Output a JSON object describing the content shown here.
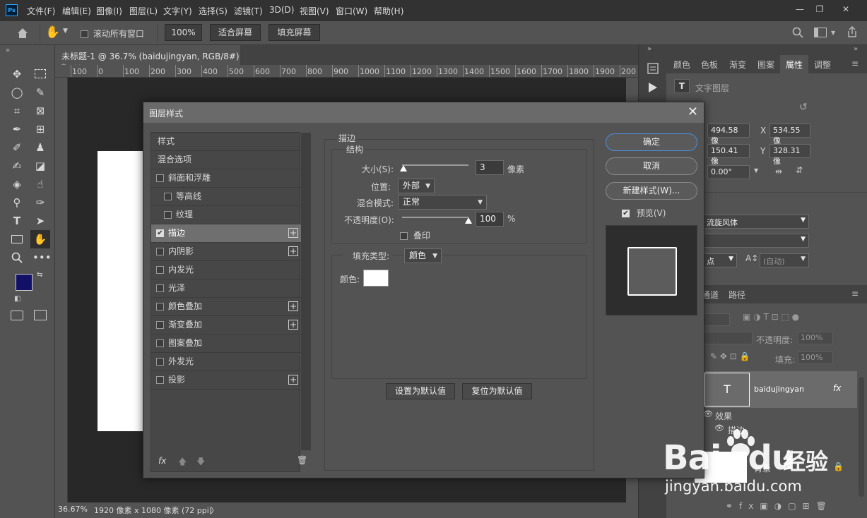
{
  "menubar": {
    "logo": "Ps",
    "items": [
      "文件(F)",
      "编辑(E)",
      "图像(I)",
      "图层(L)",
      "文字(Y)",
      "选择(S)",
      "滤镜(T)",
      "3D(D)",
      "视图(V)",
      "窗口(W)",
      "帮助(H)"
    ],
    "minimize": "—",
    "restore": "❐",
    "close": "✕"
  },
  "options": {
    "scroll_all_label": "滚动所有窗口",
    "zoom_value": "100%",
    "fit_screen": "适合屏幕",
    "fill_screen": "填充屏幕"
  },
  "document": {
    "tab_title": "未标题-1 @ 36.7% (baidujingyan, RGB/8#) *",
    "tab_close": "×",
    "ruler_ticks": [
      "100",
      "0",
      "100",
      "200",
      "300",
      "400",
      "500",
      "600",
      "700",
      "800",
      "900",
      "1000",
      "1100",
      "1200",
      "1300",
      "1400",
      "1500",
      "1600",
      "1700",
      "1800",
      "1900",
      "200"
    ],
    "zoom_status": "36.67%",
    "size_status": "1920 像素 x 1080 像素 (72 ppi)",
    "status_arrow": "〉"
  },
  "right_panel": {
    "tabs": [
      "颜色",
      "色板",
      "渐变",
      "图案",
      "属性",
      "调整"
    ],
    "active_tab": "属性",
    "layer_type": "文字图层",
    "w_value": "494.58 像",
    "x_label": "X",
    "x_value": "534.55 像",
    "h_value": "150.41 像",
    "y_label": "Y",
    "y_value": "328.31 像",
    "angle_value": "0.00°",
    "font_name": "流旋风体",
    "point_label": "点",
    "leading_value": "(自动)",
    "layers_tabs": [
      "通道",
      "路径"
    ],
    "opacity_label": "不透明度:",
    "opacity_value": "100%",
    "fill_label": "填充:",
    "fill_value": "100%",
    "layer_name": "baidujingyan",
    "effects_label": "效果",
    "effect_stroke": "描边",
    "bg_layer": "背景",
    "fx": "fx"
  },
  "dialog": {
    "title": "图层样式",
    "close": "✕",
    "styles": [
      {
        "label": "样式",
        "type": "header"
      },
      {
        "label": "混合选项",
        "type": "header"
      },
      {
        "label": "斜面和浮雕",
        "type": "check",
        "checked": false
      },
      {
        "label": "等高线",
        "type": "sub",
        "checked": false
      },
      {
        "label": "纹理",
        "type": "sub",
        "checked": false
      },
      {
        "label": "描边",
        "type": "check",
        "checked": true,
        "plus": true,
        "selected": true
      },
      {
        "label": "内阴影",
        "type": "check",
        "checked": false,
        "plus": true
      },
      {
        "label": "内发光",
        "type": "check",
        "checked": false
      },
      {
        "label": "光泽",
        "type": "check",
        "checked": false
      },
      {
        "label": "颜色叠加",
        "type": "check",
        "checked": false,
        "plus": true
      },
      {
        "label": "渐变叠加",
        "type": "check",
        "checked": false,
        "plus": true
      },
      {
        "label": "图案叠加",
        "type": "check",
        "checked": false
      },
      {
        "label": "外发光",
        "type": "check",
        "checked": false
      },
      {
        "label": "投影",
        "type": "check",
        "checked": false,
        "plus": true
      }
    ],
    "footer_fx": "fx",
    "stroke": {
      "group_title": "描边",
      "structure_title": "结构",
      "size_label": "大小(S):",
      "size_value": "3",
      "size_unit": "像素",
      "size_fraction": 0.02,
      "position_label": "位置:",
      "position_value": "外部",
      "blend_label": "混合模式:",
      "blend_value": "正常",
      "opacity_label": "不透明度(O):",
      "opacity_value": "100",
      "opacity_unit": "%",
      "opacity_fraction": 1.0,
      "overprint_label": "叠印",
      "fill_type_label": "填充类型:",
      "fill_type_value": "颜色",
      "color_label": "颜色:",
      "stroke_color": "#ffffff",
      "set_default": "设置为默认值",
      "reset_default": "复位为默认值"
    },
    "ok": "确定",
    "cancel": "取消",
    "new_style": "新建样式(W)...",
    "preview_label": "预览(V)",
    "preview_checked": true
  },
  "colors": {
    "foreground": "#131068",
    "background": "#000000",
    "dialog_ok_border": "#4a8fe0"
  },
  "watermark": {
    "brand": "Bai",
    "brand2": "du",
    "cn": "经验",
    "url": "jingyan.baidu.com"
  }
}
